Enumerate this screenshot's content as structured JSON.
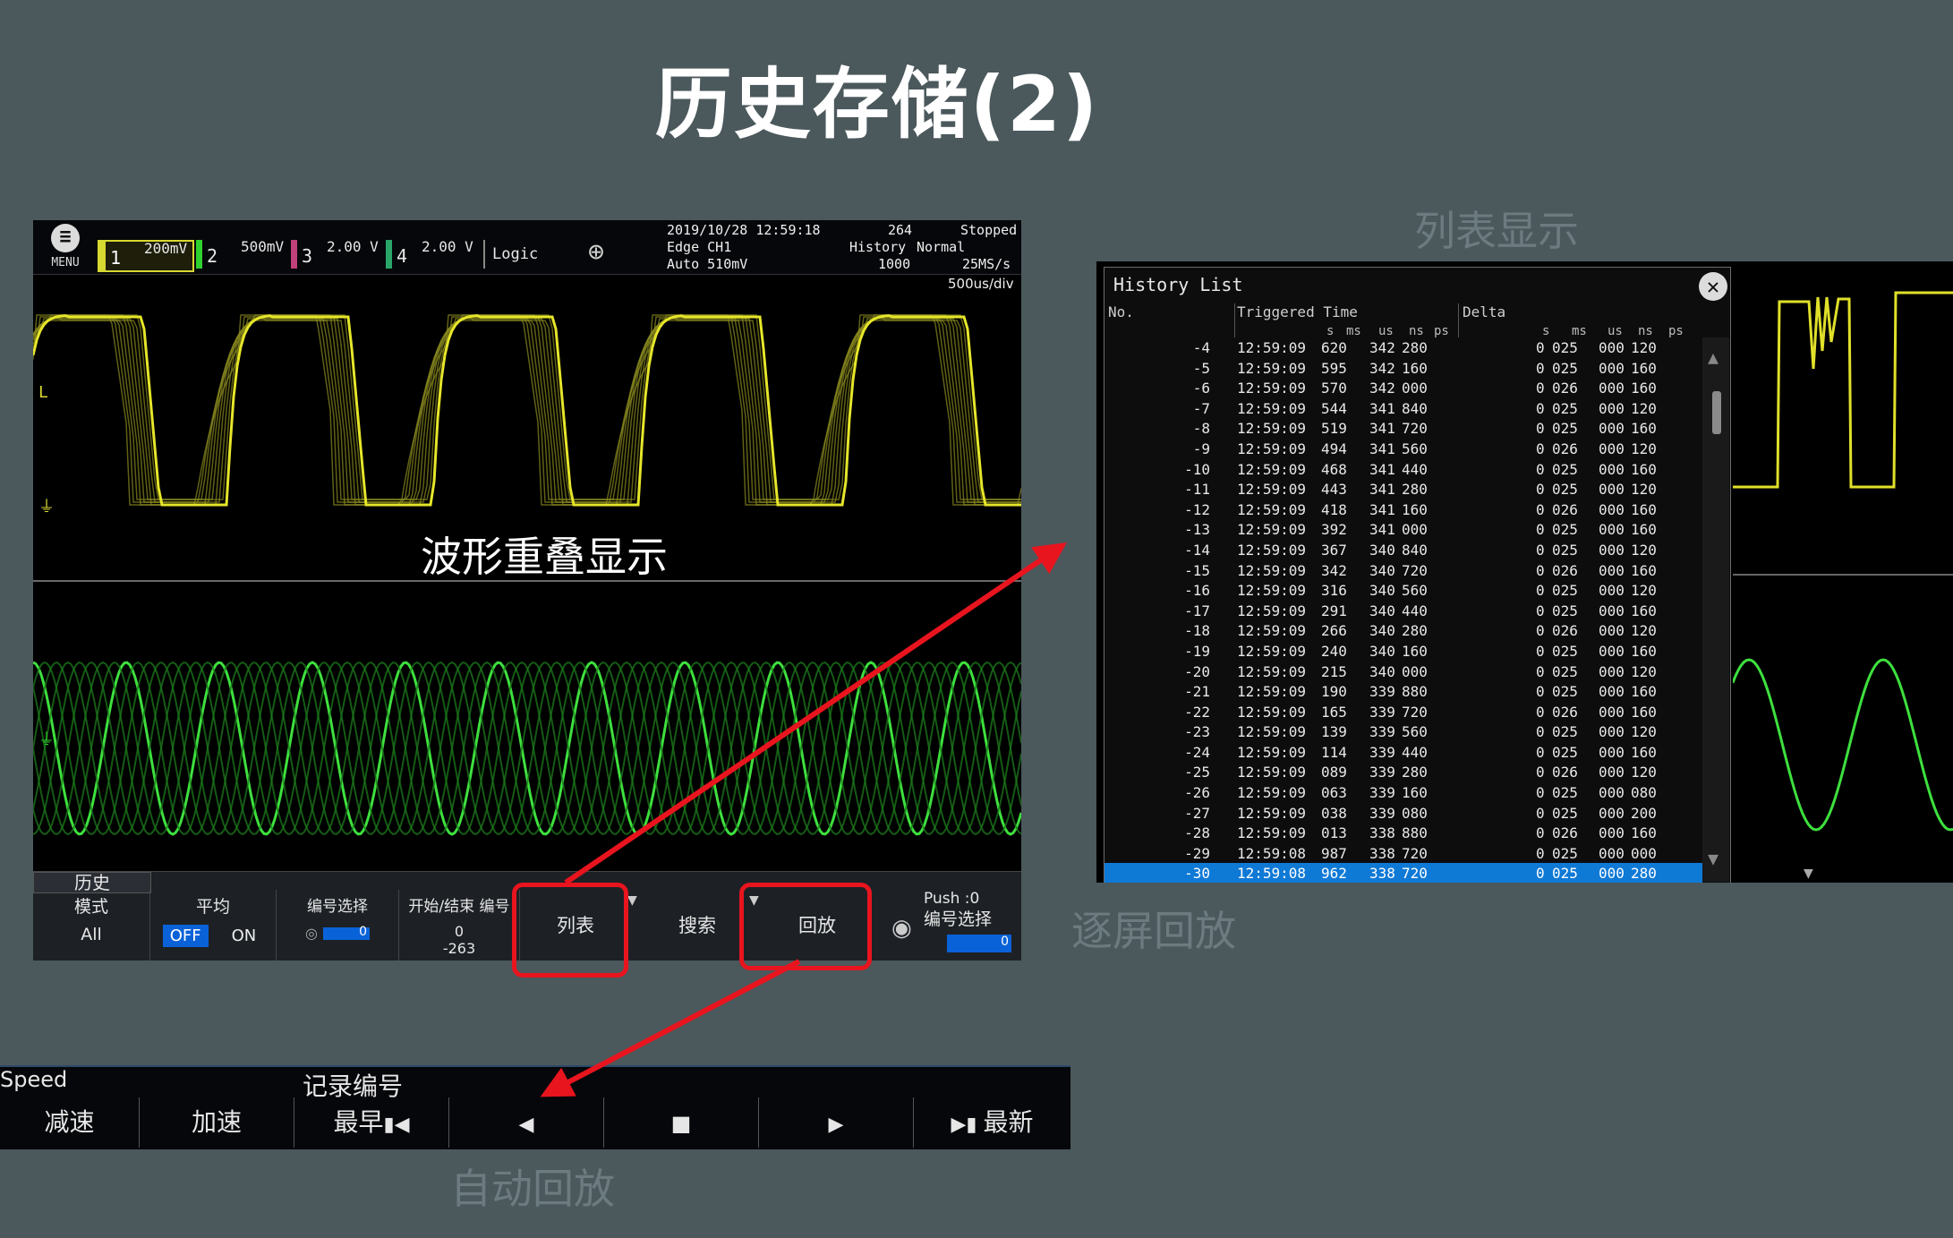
{
  "slide": {
    "title": "历史存储(2)",
    "captions": {
      "list_display": "列表显示",
      "screen_playback": "逐屏回放",
      "auto_playback": "自动回放"
    }
  },
  "scope": {
    "top_bar": {
      "menu_label": "MENU",
      "channels": [
        {
          "num": "1",
          "value": "200mV",
          "color": "#d8d832"
        },
        {
          "num": "2",
          "value": "500mV",
          "color": "#2fd12f"
        },
        {
          "num": "3",
          "value": "2.00 V",
          "color": "#c0407a"
        },
        {
          "num": "4",
          "value": "2.00 V",
          "color": "#2aa56a"
        }
      ],
      "logic_label": "Logic",
      "datetime": "2019/10/28 12:59:18",
      "trigger_source": "Edge CH1",
      "trigger_level": "Auto 510mV",
      "count": "264",
      "acq_mode": "History",
      "acq_count": "1000",
      "state": "Stopped",
      "trigger_mode": "Normal",
      "sample_rate": "25MS/s",
      "timebase": "500us/div"
    },
    "overlay_label": "波形重叠显示",
    "bottom_bar": {
      "tab": "历史",
      "mode_label": "模式",
      "mode_value": "All",
      "avg_label": "平均",
      "avg_off": "OFF",
      "avg_on": "ON",
      "num_select_label": "编号选择",
      "num_select_value": "0",
      "start_end_label": "开始/结束 编号",
      "start_value": "0",
      "end_value": "-263",
      "list_btn": "列表",
      "search_btn": "搜索",
      "replay_btn": "回放",
      "push_label": "Push",
      "push_value": ":0",
      "num_select_label2": "编号选择",
      "num_select_value2": "0"
    }
  },
  "history_list": {
    "title": "History List",
    "col_no": "No.",
    "col_time": "Triggered Time",
    "col_delta": "Delta",
    "units": [
      "s",
      "ms",
      "us",
      "ns",
      "ps"
    ],
    "rows": [
      {
        "no": "-4",
        "time": "12:59:09",
        "ms": "620",
        "us": "342",
        "ns": "280",
        "d_s": "0",
        "d_ms": "025",
        "d_us": "000",
        "d_ns": "120"
      },
      {
        "no": "-5",
        "time": "12:59:09",
        "ms": "595",
        "us": "342",
        "ns": "160",
        "d_s": "0",
        "d_ms": "025",
        "d_us": "000",
        "d_ns": "160"
      },
      {
        "no": "-6",
        "time": "12:59:09",
        "ms": "570",
        "us": "342",
        "ns": "000",
        "d_s": "0",
        "d_ms": "026",
        "d_us": "000",
        "d_ns": "160"
      },
      {
        "no": "-7",
        "time": "12:59:09",
        "ms": "544",
        "us": "341",
        "ns": "840",
        "d_s": "0",
        "d_ms": "025",
        "d_us": "000",
        "d_ns": "120"
      },
      {
        "no": "-8",
        "time": "12:59:09",
        "ms": "519",
        "us": "341",
        "ns": "720",
        "d_s": "0",
        "d_ms": "025",
        "d_us": "000",
        "d_ns": "160"
      },
      {
        "no": "-9",
        "time": "12:59:09",
        "ms": "494",
        "us": "341",
        "ns": "560",
        "d_s": "0",
        "d_ms": "026",
        "d_us": "000",
        "d_ns": "120"
      },
      {
        "no": "-10",
        "time": "12:59:09",
        "ms": "468",
        "us": "341",
        "ns": "440",
        "d_s": "0",
        "d_ms": "025",
        "d_us": "000",
        "d_ns": "160"
      },
      {
        "no": "-11",
        "time": "12:59:09",
        "ms": "443",
        "us": "341",
        "ns": "280",
        "d_s": "0",
        "d_ms": "025",
        "d_us": "000",
        "d_ns": "120"
      },
      {
        "no": "-12",
        "time": "12:59:09",
        "ms": "418",
        "us": "341",
        "ns": "160",
        "d_s": "0",
        "d_ms": "026",
        "d_us": "000",
        "d_ns": "160"
      },
      {
        "no": "-13",
        "time": "12:59:09",
        "ms": "392",
        "us": "341",
        "ns": "000",
        "d_s": "0",
        "d_ms": "025",
        "d_us": "000",
        "d_ns": "160"
      },
      {
        "no": "-14",
        "time": "12:59:09",
        "ms": "367",
        "us": "340",
        "ns": "840",
        "d_s": "0",
        "d_ms": "025",
        "d_us": "000",
        "d_ns": "120"
      },
      {
        "no": "-15",
        "time": "12:59:09",
        "ms": "342",
        "us": "340",
        "ns": "720",
        "d_s": "0",
        "d_ms": "026",
        "d_us": "000",
        "d_ns": "160"
      },
      {
        "no": "-16",
        "time": "12:59:09",
        "ms": "316",
        "us": "340",
        "ns": "560",
        "d_s": "0",
        "d_ms": "025",
        "d_us": "000",
        "d_ns": "120"
      },
      {
        "no": "-17",
        "time": "12:59:09",
        "ms": "291",
        "us": "340",
        "ns": "440",
        "d_s": "0",
        "d_ms": "025",
        "d_us": "000",
        "d_ns": "160"
      },
      {
        "no": "-18",
        "time": "12:59:09",
        "ms": "266",
        "us": "340",
        "ns": "280",
        "d_s": "0",
        "d_ms": "026",
        "d_us": "000",
        "d_ns": "120"
      },
      {
        "no": "-19",
        "time": "12:59:09",
        "ms": "240",
        "us": "340",
        "ns": "160",
        "d_s": "0",
        "d_ms": "025",
        "d_us": "000",
        "d_ns": "160"
      },
      {
        "no": "-20",
        "time": "12:59:09",
        "ms": "215",
        "us": "340",
        "ns": "000",
        "d_s": "0",
        "d_ms": "025",
        "d_us": "000",
        "d_ns": "120"
      },
      {
        "no": "-21",
        "time": "12:59:09",
        "ms": "190",
        "us": "339",
        "ns": "880",
        "d_s": "0",
        "d_ms": "025",
        "d_us": "000",
        "d_ns": "160"
      },
      {
        "no": "-22",
        "time": "12:59:09",
        "ms": "165",
        "us": "339",
        "ns": "720",
        "d_s": "0",
        "d_ms": "026",
        "d_us": "000",
        "d_ns": "160"
      },
      {
        "no": "-23",
        "time": "12:59:09",
        "ms": "139",
        "us": "339",
        "ns": "560",
        "d_s": "0",
        "d_ms": "025",
        "d_us": "000",
        "d_ns": "120"
      },
      {
        "no": "-24",
        "time": "12:59:09",
        "ms": "114",
        "us": "339",
        "ns": "440",
        "d_s": "0",
        "d_ms": "025",
        "d_us": "000",
        "d_ns": "160"
      },
      {
        "no": "-25",
        "time": "12:59:09",
        "ms": "089",
        "us": "339",
        "ns": "280",
        "d_s": "0",
        "d_ms": "026",
        "d_us": "000",
        "d_ns": "120"
      },
      {
        "no": "-26",
        "time": "12:59:09",
        "ms": "063",
        "us": "339",
        "ns": "160",
        "d_s": "0",
        "d_ms": "025",
        "d_us": "000",
        "d_ns": "080"
      },
      {
        "no": "-27",
        "time": "12:59:09",
        "ms": "038",
        "us": "339",
        "ns": "080",
        "d_s": "0",
        "d_ms": "025",
        "d_us": "000",
        "d_ns": "200"
      },
      {
        "no": "-28",
        "time": "12:59:09",
        "ms": "013",
        "us": "338",
        "ns": "880",
        "d_s": "0",
        "d_ms": "026",
        "d_us": "000",
        "d_ns": "160"
      },
      {
        "no": "-29",
        "time": "12:59:08",
        "ms": "987",
        "us": "338",
        "ns": "720",
        "d_s": "0",
        "d_ms": "025",
        "d_us": "000",
        "d_ns": "000"
      },
      {
        "no": "-30",
        "time": "12:59:08",
        "ms": "962",
        "us": "338",
        "ns": "720",
        "d_s": "0",
        "d_ms": "025",
        "d_us": "000",
        "d_ns": "280",
        "selected": true
      }
    ]
  },
  "playback_bar": {
    "speed_label": "Speed",
    "record_label": "记录编号",
    "buttons": [
      {
        "label": "减速",
        "icon": ""
      },
      {
        "label": "加速",
        "icon": ""
      },
      {
        "label": "最早",
        "icon": "skip-first-icon"
      },
      {
        "label": "",
        "icon": "step-back-icon"
      },
      {
        "label": "",
        "icon": "stop-icon"
      },
      {
        "label": "",
        "icon": "play-icon"
      },
      {
        "label": "最新",
        "icon": "skip-last-icon"
      }
    ]
  },
  "colors": {
    "background": "#4b585c",
    "ch1": "#d8d832",
    "ch2": "#2fd12f",
    "highlight": "#e8141e",
    "selected_row": "#0f79d6",
    "caption": "#6c7b80"
  }
}
